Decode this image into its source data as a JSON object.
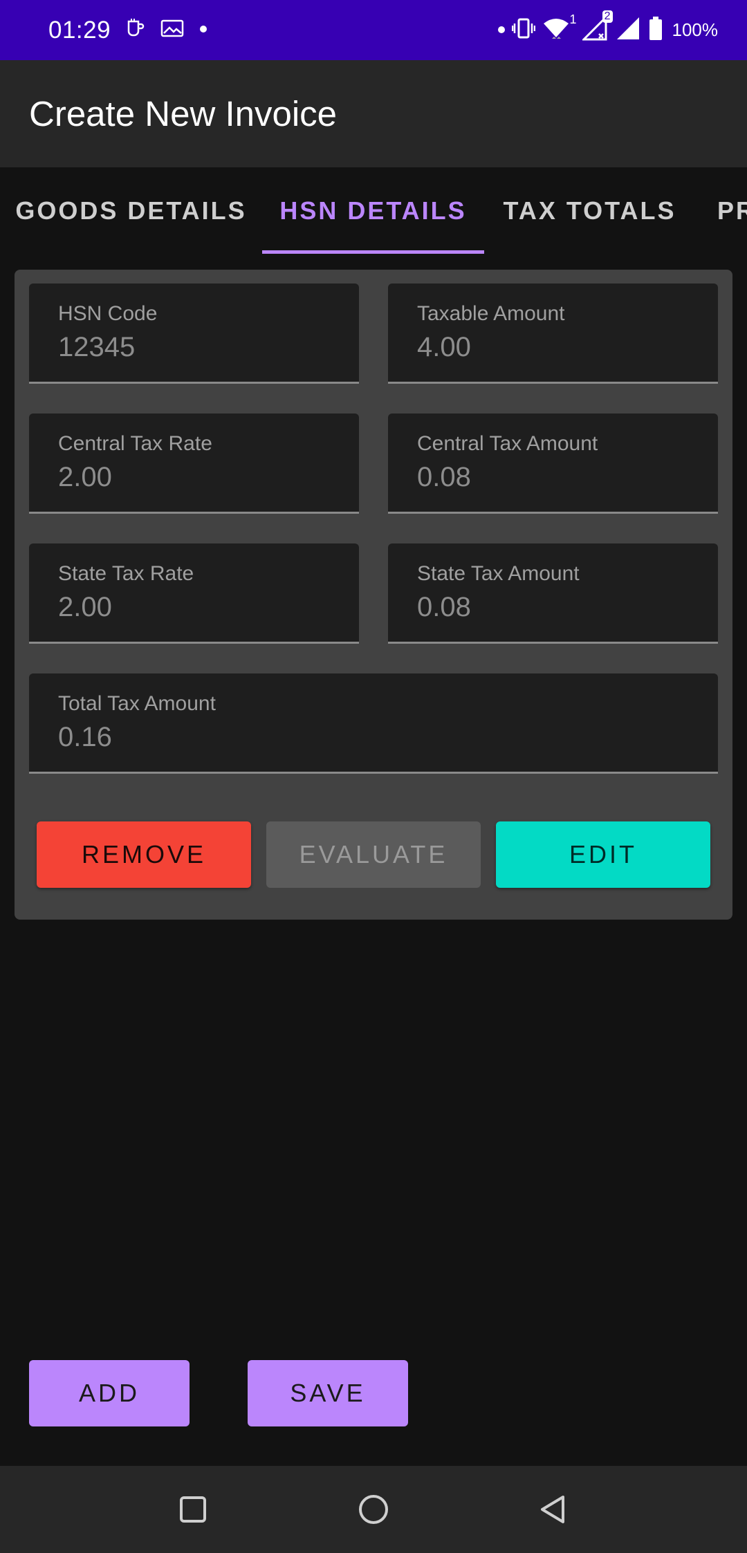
{
  "status_bar": {
    "time": "01:29",
    "battery_percent": "100%",
    "sim_badge_1": "1",
    "sim_badge_2": "2",
    "icons": [
      "tea-cup-icon",
      "image-icon",
      "dot-icon",
      "dot-icon",
      "vibrate-icon",
      "wifi-icon",
      "signal-icon",
      "signal-icon",
      "battery-icon"
    ]
  },
  "app_bar": {
    "title": "Create New Invoice"
  },
  "tabs": [
    {
      "label": "GOODS DETAILS",
      "active": false
    },
    {
      "label": "HSN DETAILS",
      "active": true
    },
    {
      "label": "TAX TOTALS",
      "active": false
    },
    {
      "label": "PR",
      "active": false
    }
  ],
  "form": {
    "hsn_code": {
      "label": "HSN Code",
      "value": "12345"
    },
    "taxable_amount": {
      "label": "Taxable Amount",
      "value": "4.00"
    },
    "central_tax_rate": {
      "label": "Central Tax Rate",
      "value": "2.00"
    },
    "central_tax_amount": {
      "label": "Central Tax Amount",
      "value": "0.08"
    },
    "state_tax_rate": {
      "label": "State Tax Rate",
      "value": "2.00"
    },
    "state_tax_amount": {
      "label": "State Tax Amount",
      "value": "0.08"
    },
    "total_tax_amount": {
      "label": "Total Tax Amount",
      "value": "0.16"
    }
  },
  "actions": {
    "remove": "REMOVE",
    "evaluate": "EVALUATE",
    "edit": "EDIT"
  },
  "bottom_actions": {
    "add": "ADD",
    "save": "SAVE"
  },
  "nav_bar": {
    "icons": [
      "recents-square-icon",
      "home-circle-icon",
      "back-triangle-icon"
    ]
  },
  "colors": {
    "status_bar": "#3700B3",
    "accent": "#BB86FC",
    "remove": "#F44336",
    "edit": "#03DAC5",
    "surface": "#424242"
  }
}
